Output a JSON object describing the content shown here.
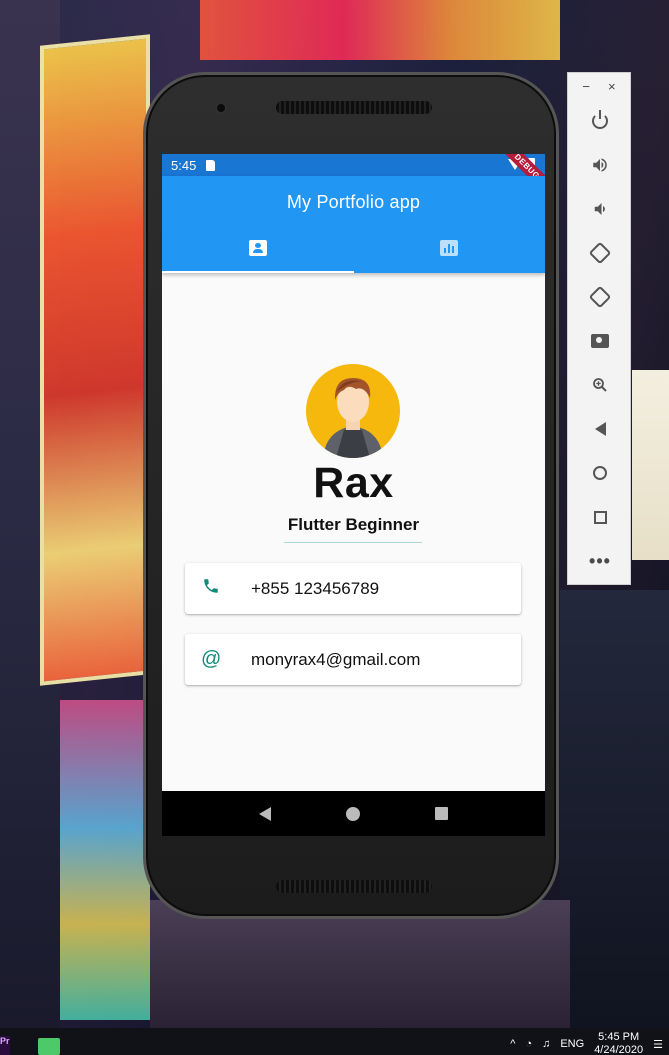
{
  "device": {
    "status_bar": {
      "time": "5:45",
      "debug_label": "DEBUG"
    },
    "app_bar": {
      "title": "My Portfolio app",
      "tabs": [
        {
          "icon": "contact-card-icon",
          "active": true
        },
        {
          "icon": "bar-chart-icon",
          "active": false
        }
      ],
      "color": "#2196f3"
    },
    "profile": {
      "name": "Rax",
      "subtitle": "Flutter Beginner",
      "avatar_icon": "avatar-icon"
    },
    "contacts": [
      {
        "icon": "phone-icon",
        "value": "+855 123456789"
      },
      {
        "icon": "at-sign-icon",
        "value": "monyrax4@gmail.com"
      }
    ],
    "accent_color": "#128a7a"
  },
  "emulator_toolbar": {
    "window_controls": [
      "−",
      "×"
    ],
    "buttons": [
      "power-icon",
      "volume-up-icon",
      "volume-down-icon",
      "rotate-left-icon",
      "rotate-right-icon",
      "camera-icon",
      "zoom-icon",
      "back-icon",
      "home-icon",
      "overview-icon",
      "more-icon"
    ],
    "more_label": "•••"
  },
  "taskbar": {
    "language": "ENG",
    "clock_time": "5:45 PM",
    "clock_date": "4/24/2020"
  }
}
